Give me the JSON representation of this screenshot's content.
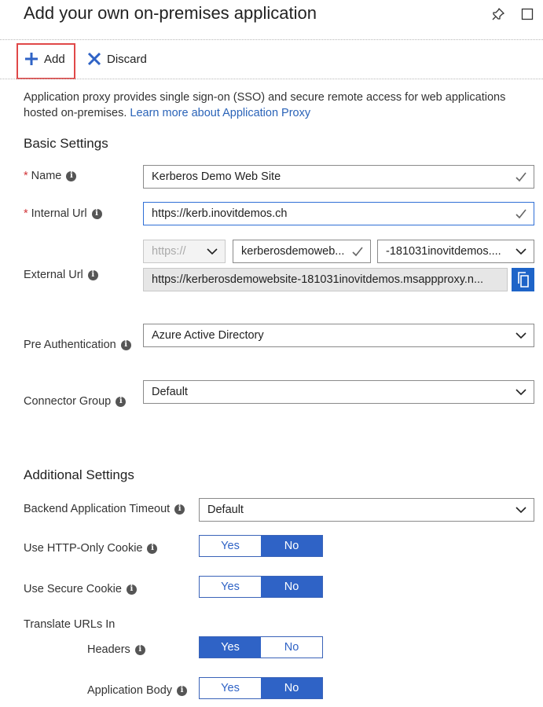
{
  "header": {
    "title": "Add your own on-premises application"
  },
  "toolbar": {
    "add_label": "Add",
    "discard_label": "Discard"
  },
  "description": {
    "text": "Application proxy provides single sign-on (SSO) and secure remote access for web applications hosted on-premises.",
    "link": "Learn more about Application Proxy"
  },
  "basic": {
    "heading": "Basic Settings",
    "name": {
      "label": "Name",
      "value": "Kerberos Demo Web Site"
    },
    "internal_url": {
      "label": "Internal Url",
      "value": "https://kerb.inovitdemos.ch"
    },
    "external_url": {
      "label": "External Url",
      "scheme": "https://",
      "subdomain": "kerberosdemoweb...",
      "domain": "-181031inovitdemos....",
      "full": "https://kerberosdemowebsite-181031inovitdemos.msappproxy.n..."
    },
    "pre_auth": {
      "label": "Pre Authentication",
      "value": "Azure Active Directory"
    },
    "connector_group": {
      "label": "Connector Group",
      "value": "Default"
    }
  },
  "additional": {
    "heading": "Additional Settings",
    "backend_timeout": {
      "label": "Backend Application Timeout",
      "value": "Default"
    },
    "http_only_cookie": {
      "label": "Use HTTP-Only Cookie",
      "selected": "No"
    },
    "secure_cookie": {
      "label": "Use Secure Cookie",
      "selected": "No"
    },
    "translate_heading": "Translate URLs In",
    "headers": {
      "label": "Headers",
      "selected": "Yes"
    },
    "application_body": {
      "label": "Application Body",
      "selected": "No"
    },
    "yes_label": "Yes",
    "no_label": "No"
  },
  "colors": {
    "accent": "#2f63c6",
    "required": "#d13438",
    "highlight_box": "#e04848"
  }
}
